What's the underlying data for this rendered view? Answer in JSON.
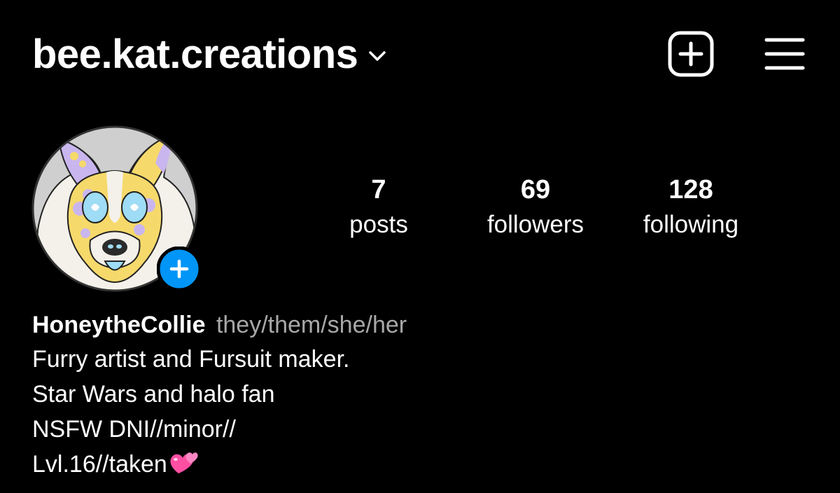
{
  "header": {
    "username": "bee.kat.creations",
    "chevron_icon": "chevron-down-icon",
    "new_post_icon": "plus-square-icon",
    "menu_icon": "hamburger-menu-icon"
  },
  "profile": {
    "avatar_icon": "collie-avatar",
    "add_story_icon": "plus-icon",
    "add_story_color": "#0095f6"
  },
  "stats": {
    "posts": {
      "count": "7",
      "label": "posts"
    },
    "followers": {
      "count": "69",
      "label": "followers"
    },
    "following": {
      "count": "128",
      "label": "following"
    }
  },
  "bio": {
    "name": "HoneytheCollie",
    "pronouns": "they/them/she/her",
    "lines": [
      "Furry artist and Fursuit maker.",
      "Star Wars and halo fan",
      "NSFW DNI//minor//",
      "Lvl.16//taken"
    ],
    "emoji_icon": "two-hearts-emoji"
  },
  "colors": {
    "background": "#000000",
    "text": "#ffffff",
    "muted": "#a8a8a8",
    "accent": "#0095f6"
  }
}
